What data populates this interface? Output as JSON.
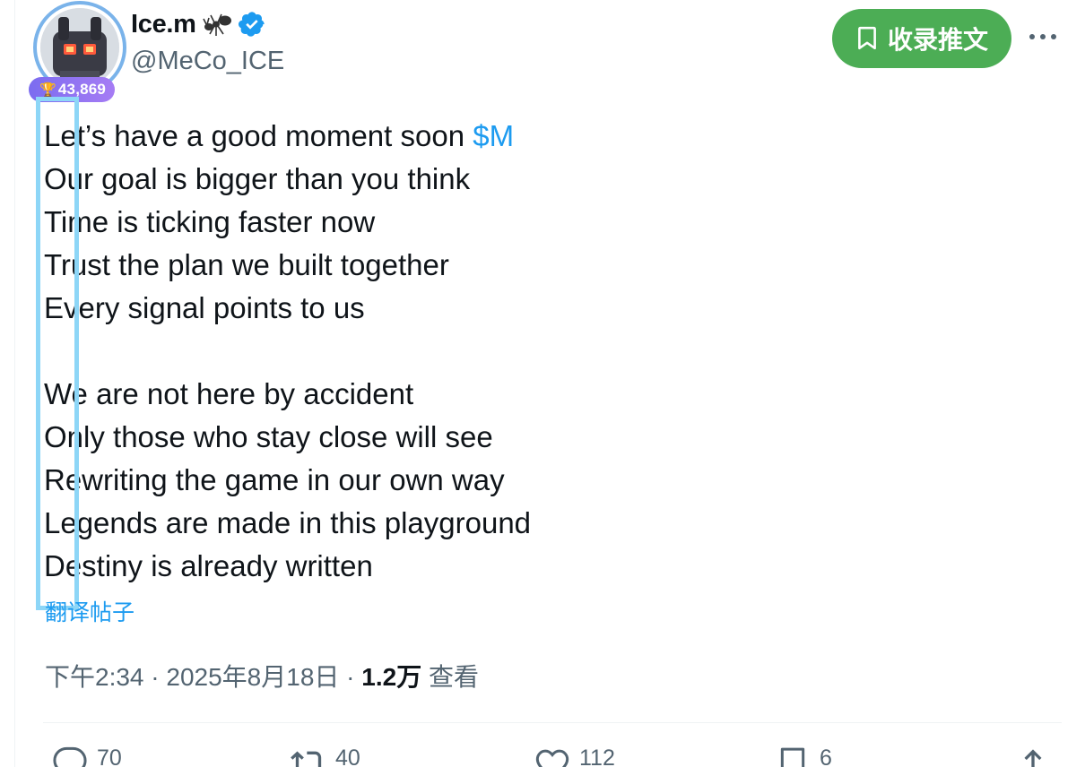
{
  "author": {
    "display_name": "Ice.m",
    "handle": "@MeCo_ICE",
    "score_badge": "43,869",
    "verified": true,
    "icons": [
      "ant-icon",
      "verified-icon",
      "trophy-icon"
    ]
  },
  "header": {
    "subscribe_label": "收录推文",
    "subscribe_color": "#4cad55",
    "more_icon": "more-horizontal-icon"
  },
  "tweet": {
    "line_1": "Let’s have a good moment soon ",
    "cashtag": "$M",
    "lines_a": [
      "Our goal is bigger than you think",
      "Time is ticking faster now",
      "Trust the plan we built together",
      "Every signal points to us"
    ],
    "lines_b": [
      "We are not here by accident",
      "Only those who stay close will see",
      "Rewriting the game in our own way",
      "Legends are made in this playground",
      "Destiny is already written"
    ],
    "translate_link": "翻译帖子"
  },
  "meta": {
    "time": "下午2:34",
    "separator": " · ",
    "date": "2025年8月18日",
    "views_count": "1.2万",
    "views_label": "查看"
  },
  "actions": {
    "replies": "70",
    "reposts": "40",
    "likes": "112",
    "bookmarks": "6"
  },
  "colors": {
    "link": "#1d9bf0",
    "text": "#0f1419",
    "muted": "#536471",
    "highlight": "#8dd6f7",
    "badge": "#8b72f2"
  }
}
